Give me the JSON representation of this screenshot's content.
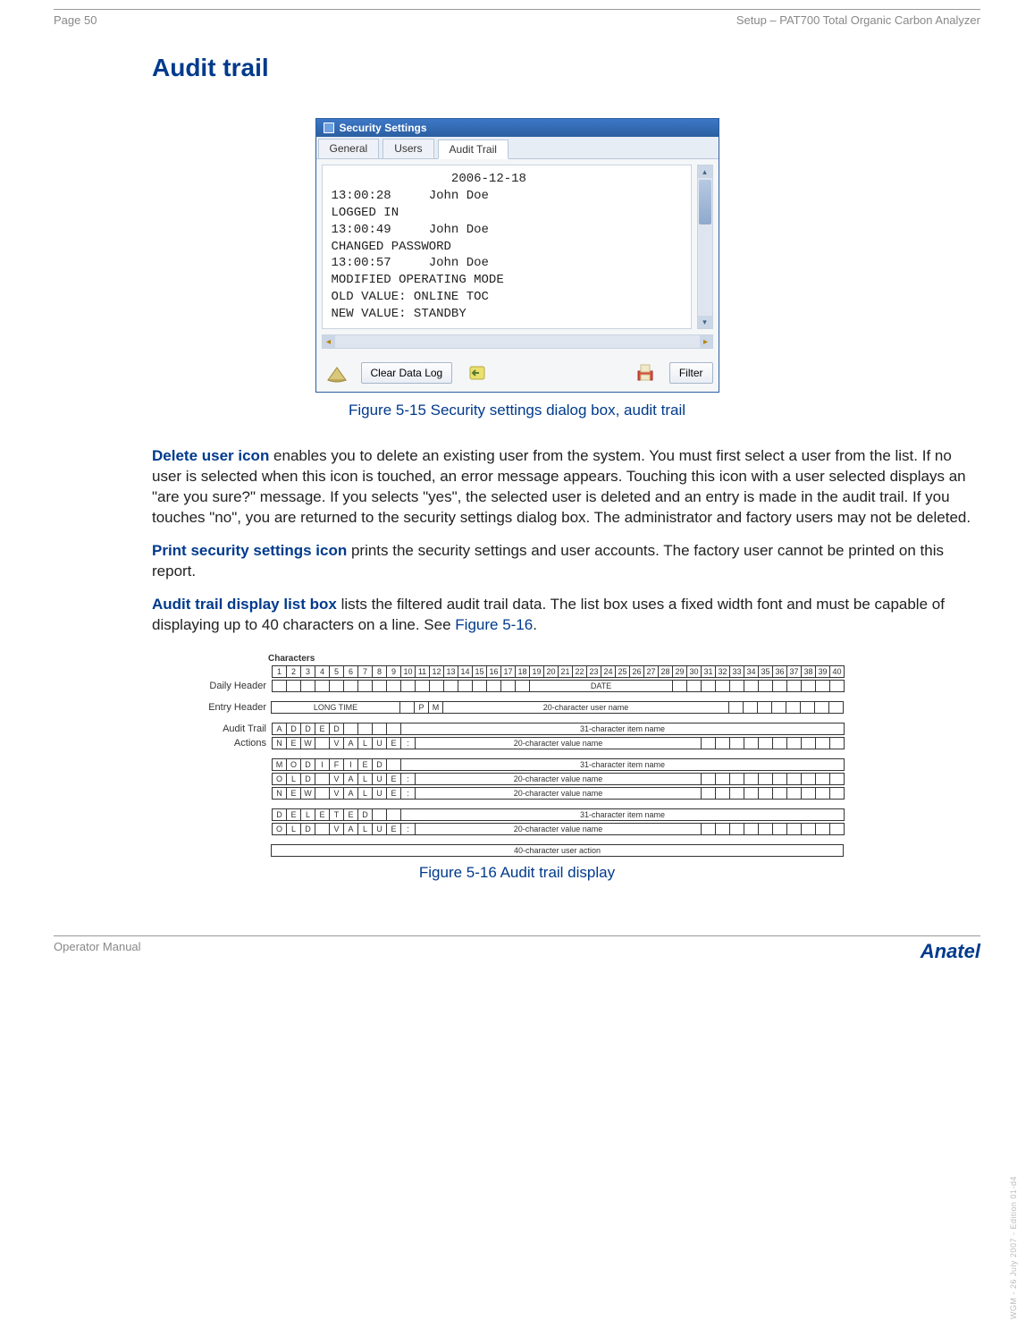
{
  "header": {
    "page_label": "Page 50",
    "doc_title": "Setup – PAT700 Total Organic Carbon Analyzer"
  },
  "section": {
    "title": "Audit trail"
  },
  "screenshot": {
    "window_title": "Security Settings",
    "tabs": [
      "General",
      "Users",
      "Audit Trail"
    ],
    "active_tab_index": 2,
    "log_text": "                2006-12-18\n13:00:28     John Doe\nLOGGED IN\n13:00:49     John Doe\nCHANGED PASSWORD\n13:00:57     John Doe\nMODIFIED OPERATING MODE\nOLD VALUE: ONLINE TOC\nNEW VALUE: STANDBY",
    "clear_button": "Clear Data Log",
    "filter_button": "Filter"
  },
  "fig1_caption": "Figure 5-15 Security settings dialog box, audit trail",
  "para1": {
    "lead": "Delete user icon",
    "text": " enables you to delete an existing user from the system. You must first select a user from the list. If no user is selected when this icon is touched, an error message appears. Touching this icon with a user selected displays an \"are you sure?\" message. If you selects \"yes\", the selected user is deleted and an entry is made in the audit trail. If you touches \"no\", you are returned to the security settings dialog box. The administrator and factory users may not be deleted."
  },
  "para2": {
    "lead": "Print security settings icon",
    "text": " prints the security settings and user accounts. The factory user cannot be printed on this report."
  },
  "para3": {
    "lead": "Audit trail display list box",
    "text": " lists the filtered audit trail data. The list box uses a fixed width font and must be capable of displaying up to 40 characters on a line. See ",
    "link": "Figure 5-16",
    "tail": "."
  },
  "char_table": {
    "title": "Characters",
    "numbers": [
      "1",
      "2",
      "3",
      "4",
      "5",
      "6",
      "7",
      "8",
      "9",
      "10",
      "11",
      "12",
      "13",
      "14",
      "15",
      "16",
      "17",
      "18",
      "19",
      "20",
      "21",
      "22",
      "23",
      "24",
      "25",
      "26",
      "27",
      "28",
      "29",
      "30",
      "31",
      "32",
      "33",
      "34",
      "35",
      "36",
      "37",
      "38",
      "39",
      "40"
    ],
    "daily_header": {
      "label": "Daily Header",
      "wide_text": "DATE"
    },
    "entry_header": {
      "label": "Entry Header",
      "long_time": "LONG TIME",
      "pm_p": "P",
      "pm_m": "M",
      "user_name": "20-character user name"
    },
    "audit_label1": "Audit Trail",
    "audit_label2": "Actions",
    "row_added": {
      "cells": [
        "A",
        "D",
        "D",
        "E",
        "D",
        "",
        "",
        "",
        ""
      ],
      "wide": "31-character item name"
    },
    "row_new_value": {
      "cells": [
        "N",
        "E",
        "W",
        "",
        "V",
        "A",
        "L",
        "U",
        "E"
      ],
      "colon": ":",
      "wide": "20-character value name"
    },
    "row_modified": {
      "cells": [
        "M",
        "O",
        "D",
        "I",
        "F",
        "I",
        "E",
        "D",
        ""
      ],
      "wide": "31-character item name"
    },
    "row_old_value": {
      "cells": [
        "O",
        "L",
        "D",
        "",
        "V",
        "A",
        "L",
        "U",
        "E"
      ],
      "colon": ":",
      "wide": "20-character value name"
    },
    "row_new_value2": {
      "cells": [
        "N",
        "E",
        "W",
        "",
        "V",
        "A",
        "L",
        "U",
        "E"
      ],
      "colon": ":",
      "wide": "20-character value name"
    },
    "row_deleted": {
      "cells": [
        "D",
        "E",
        "L",
        "E",
        "T",
        "E",
        "D",
        "",
        ""
      ],
      "wide": "31-character item name"
    },
    "row_old_value2": {
      "cells": [
        "O",
        "L",
        "D",
        "",
        "V",
        "A",
        "L",
        "U",
        "E"
      ],
      "colon": ":",
      "wide": "20-character value name"
    },
    "row_user_action": "40-character user action"
  },
  "fig2_caption": "Figure 5-16 Audit trail display",
  "footer": {
    "left": "Operator Manual",
    "right": "Anatel"
  },
  "side": "WGM - 26 July 2007 - Edition 01-d4"
}
